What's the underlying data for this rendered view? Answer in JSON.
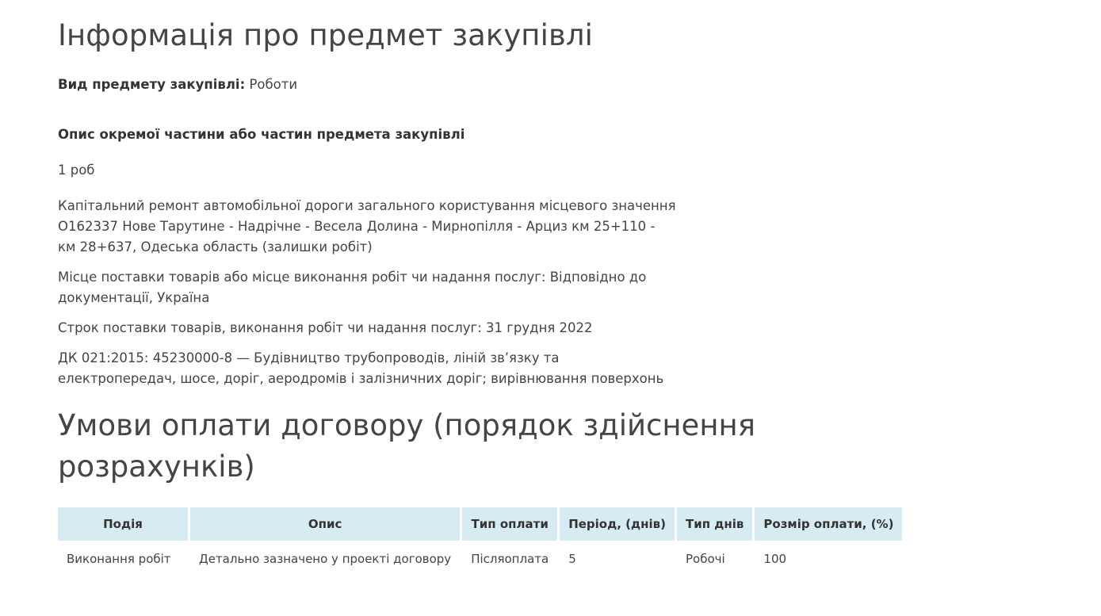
{
  "info": {
    "title": "Інформація про предмет закупівлі",
    "kind_label": "Вид предмету закупівлі:",
    "kind_value": "Роботи",
    "lot_section_title": "Опис окремої частини або частин предмета закупівлі",
    "lot_quantity": "1 роб",
    "lot_description": "Капітальний ремонт автомобільної дороги загального користування місцевого значення О162337 Нове Тарутине - Надрічне - Весела Долина - Мирнопілля - Арциз км 25+110 - км 28+637, Одеська область (залишки робіт)",
    "delivery_place": "Місце поставки товарів або місце виконання робіт чи надання послуг: Відповідно до документації, Україна",
    "delivery_term": "Строк поставки товарів, виконання робіт чи надання послуг: 31 грудня 2022",
    "classifier": "ДК 021:2015: 45230000-8 — Будівництво трубопроводів, ліній зв’язку та електропередач, шосе, доріг, аеродромів і залізничних доріг; вирівнювання поверхонь"
  },
  "payment": {
    "title": "Умови оплати договору (порядок здійснення розрахунків)",
    "columns": [
      "Подія",
      "Опис",
      "Тип оплати",
      "Період, (днів)",
      "Тип днів",
      "Розмір оплати, (%)"
    ],
    "rows": [
      [
        "Виконання робіт",
        "Детально зазначено у проекті договору",
        "Післяоплата",
        "5",
        "Робочі",
        "100"
      ]
    ]
  },
  "colors": {
    "table_header_bg": "#d6ebf2",
    "text": "#444444"
  }
}
